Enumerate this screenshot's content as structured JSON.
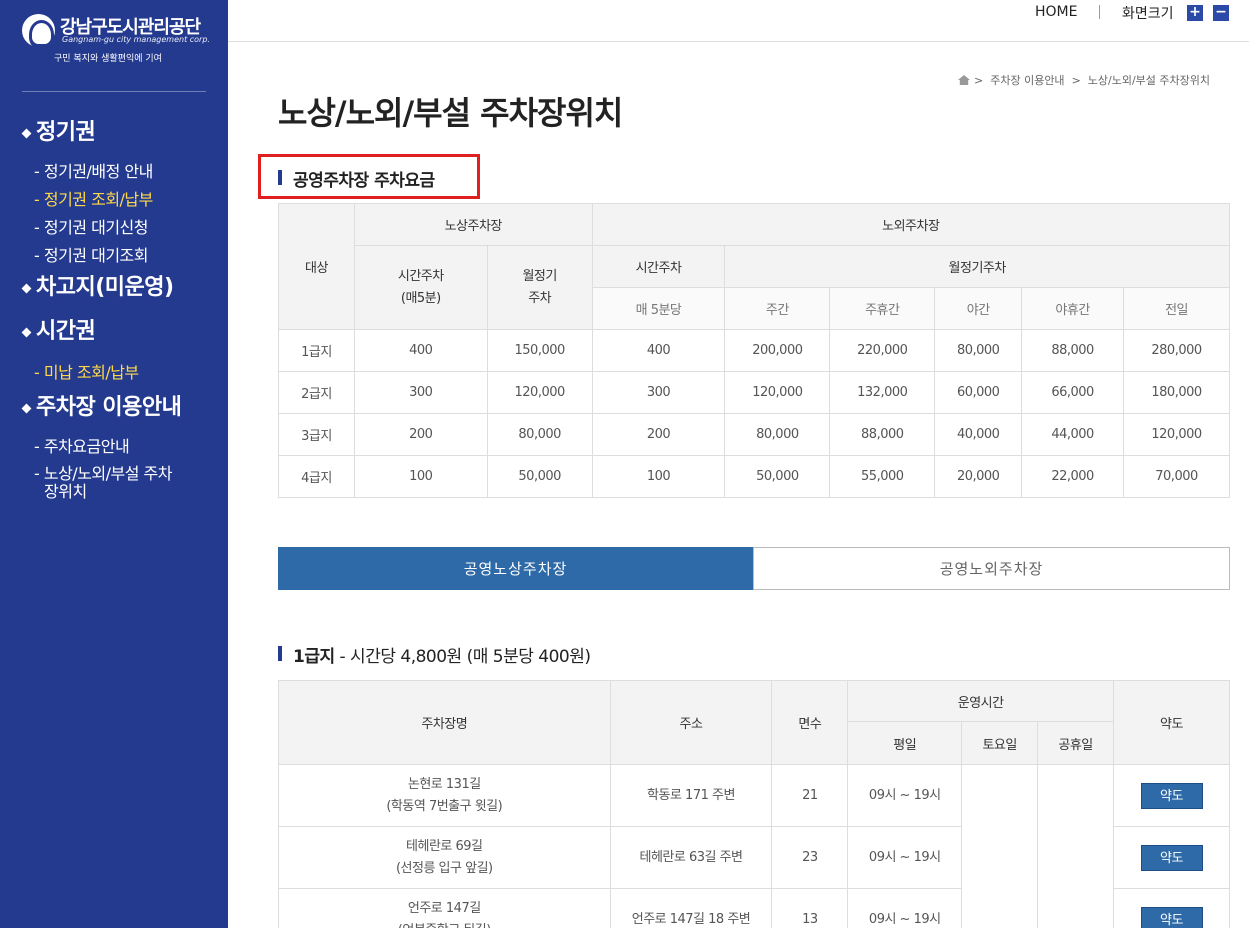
{
  "sidebar": {
    "logo": {
      "name": "강남구도시관리공단",
      "english": "Gangnam-gu city management corp.",
      "slogan": "구민 복지와 생활편익에 기여"
    },
    "menu": [
      {
        "label": "정기권",
        "items": [
          {
            "label": "- 정기권/배정 안내",
            "active": false
          },
          {
            "label": "- 정기권 조회/납부",
            "active": true
          },
          {
            "label": "- 정기권 대기신청",
            "active": false
          },
          {
            "label": "- 정기권 대기조회",
            "active": false
          }
        ]
      },
      {
        "label": "차고지(미운영)",
        "items": []
      },
      {
        "label": "시간권",
        "items": [
          {
            "label": "- 미납 조회/납부",
            "active": true
          }
        ]
      },
      {
        "label": "주차장 이용안내",
        "items": [
          {
            "label": "- 주차요금안내",
            "active": false
          },
          {
            "label": "- 노상/노외/부설 주차장위치",
            "active": false
          }
        ]
      }
    ]
  },
  "topbar": {
    "home": "HOME",
    "zoom_label": "화면크기",
    "zoom_in": "+",
    "zoom_out": "−"
  },
  "breadcrumb": {
    "level1": "주차장 이용안내",
    "level2": "노상/노외/부설 주차장위치",
    "sep": ">"
  },
  "page_title": "노상/노외/부설 주차장위치",
  "fee_section": {
    "heading": "공영주차장 주차요금",
    "headers": {
      "target": "대상",
      "onstreet": "노상주차장",
      "offstreet": "노외주차장",
      "onstreet_hourly": "시간주차\n(매5분)",
      "onstreet_monthly": "월정기\n주차",
      "offstreet_hourly": "시간주차",
      "offstreet_monthly": "월정기주차",
      "per5min": "매 5분당",
      "day": "주간",
      "day_holiday": "주휴간",
      "night": "야간",
      "night_holiday": "야휴간",
      "allday": "전일"
    },
    "rows": [
      [
        "1급지",
        "400",
        "150,000",
        "400",
        "200,000",
        "220,000",
        "80,000",
        "88,000",
        "280,000"
      ],
      [
        "2급지",
        "300",
        "120,000",
        "300",
        "120,000",
        "132,000",
        "60,000",
        "66,000",
        "180,000"
      ],
      [
        "3급지",
        "200",
        "80,000",
        "200",
        "80,000",
        "88,000",
        "40,000",
        "44,000",
        "120,000"
      ],
      [
        "4급지",
        "100",
        "50,000",
        "100",
        "50,000",
        "55,000",
        "20,000",
        "22,000",
        "70,000"
      ]
    ]
  },
  "tabs": [
    {
      "label": "공영노상주차장",
      "active": true
    },
    {
      "label": "공영노외주차장",
      "active": false
    }
  ],
  "grade_section": {
    "grade": "1급지",
    "detail": "- 시간당 4,800원 (매 5분당 400원)",
    "headers": {
      "name": "주차장명",
      "address": "주소",
      "spaces": "면수",
      "hours": "운영시간",
      "weekday": "평일",
      "saturday": "토요일",
      "holiday": "공휴일",
      "map": "약도"
    },
    "rows": [
      {
        "name": "논현로 131길",
        "note": "(학동역 7번출구 윗길)",
        "address": "학동로 171 주변",
        "spaces": "21",
        "weekday": "09시 ~ 19시",
        "map": "약도"
      },
      {
        "name": "테헤란로 69길",
        "note": "(선정릉 입구 앞길)",
        "address": "테헤란로 63길 주변",
        "spaces": "23",
        "weekday": "09시 ~ 19시",
        "map": "약도"
      },
      {
        "name": "언주로 147길",
        "note": "(언북중학교 뒤길)",
        "address": "언주로 147길 18 주변",
        "spaces": "13",
        "weekday": "09시 ~ 19시",
        "map": "약도"
      }
    ]
  }
}
